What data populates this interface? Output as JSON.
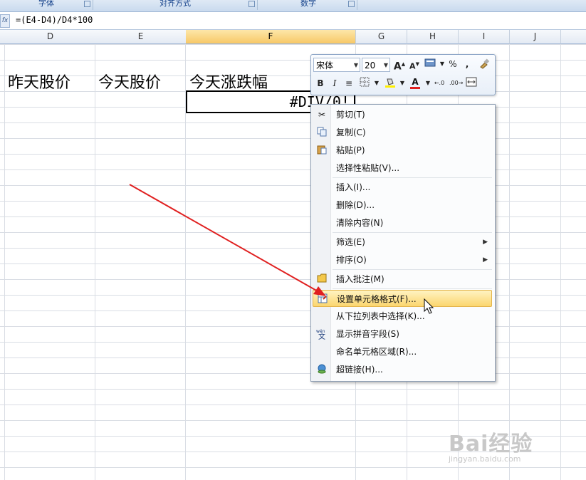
{
  "ribbon": {
    "groups": [
      {
        "label": "字体"
      },
      {
        "label": "对齐方式"
      },
      {
        "label": "数字"
      }
    ]
  },
  "formula_bar": {
    "fx_icon": "fx-icon",
    "formula": "=(E4-D4)/D4*100"
  },
  "columns": [
    "D",
    "E",
    "F",
    "G",
    "H",
    "I",
    "J"
  ],
  "selected_column": "F",
  "cells": {
    "d_header": "昨天股价",
    "e_header": "今天股价",
    "f_header": "今天涨跌幅",
    "f_value": "#DIV/0!"
  },
  "mini_toolbar": {
    "font_name": "宋体",
    "font_size": "20",
    "grow_label": "A",
    "shrink_label": "A",
    "percent_label": "%",
    "comma_label": ",",
    "bold_label": "B",
    "italic_label": "I",
    "font_color_label": "A",
    "inc_decimal_label": ".0",
    "dec_decimal_label": ".00"
  },
  "context_menu": {
    "items": [
      {
        "label": "剪切(T)",
        "icon": "scissors-icon"
      },
      {
        "label": "复制(C)",
        "icon": "copy-icon"
      },
      {
        "label": "粘贴(P)",
        "icon": "paste-icon"
      },
      {
        "label": "选择性粘贴(V)..."
      },
      {
        "label": "插入(I)..."
      },
      {
        "label": "删除(D)..."
      },
      {
        "label": "清除内容(N)"
      },
      {
        "label": "筛选(E)"
      },
      {
        "label": "排序(O)"
      },
      {
        "label": "插入批注(M)",
        "icon": "comment-icon"
      },
      {
        "label": "设置单元格格式(F)...",
        "icon": "format-cells-icon"
      },
      {
        "label": "从下拉列表中选择(K)..."
      },
      {
        "label": "显示拼音字段(S)",
        "icon": "phonetic-icon"
      },
      {
        "label": "命名单元格区域(R)..."
      },
      {
        "label": "超链接(H)...",
        "icon": "hyperlink-icon"
      }
    ],
    "highlighted_index": 10
  },
  "watermark": {
    "brand": "Bai经验",
    "url": "jingyan.baidu.com"
  },
  "colors": {
    "annotation_arrow": "#e02020",
    "highlight": "#fbd66f"
  }
}
